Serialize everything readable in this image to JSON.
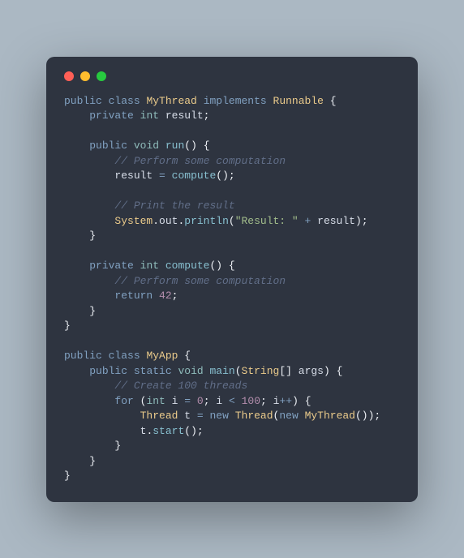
{
  "code": {
    "l1": {
      "kw1": "public",
      "kw2": "class",
      "cls": "MyThread",
      "kw3": "implements",
      "cls2": "Runnable",
      "br": "{"
    },
    "l2": {
      "kw1": "private",
      "tp": "int",
      "id": "result",
      "sc": ";"
    },
    "l3": {
      "kw1": "public",
      "tp": "void",
      "fn": "run",
      "p1": "(",
      "p2": ")",
      "br": "{"
    },
    "l4": {
      "cm": "// Perform some computation"
    },
    "l5": {
      "id1": "result",
      "op": "=",
      "fn": "compute",
      "p1": "(",
      "p2": ")",
      "sc": ";"
    },
    "l6": {
      "cm": "// Print the result"
    },
    "l7": {
      "cls": "System",
      "d1": ".",
      "id": "out",
      "d2": ".",
      "fn": "println",
      "p1": "(",
      "st": "\"Result: \"",
      "op": "+",
      "id2": "result",
      "p2": ")",
      "sc": ";"
    },
    "l8": {
      "br": "}"
    },
    "l9": {
      "kw1": "private",
      "tp": "int",
      "fn": "compute",
      "p1": "(",
      "p2": ")",
      "br": "{"
    },
    "l10": {
      "cm": "// Perform some computation"
    },
    "l11": {
      "kw": "return",
      "nu": "42",
      "sc": ";"
    },
    "l12": {
      "br": "}"
    },
    "l13": {
      "br": "}"
    },
    "l14": {
      "kw1": "public",
      "kw2": "class",
      "cls": "MyApp",
      "br": "{"
    },
    "l15": {
      "kw1": "public",
      "kw2": "static",
      "tp": "void",
      "fn": "main",
      "p1": "(",
      "tp2": "String",
      "brk": "[]",
      "id": "args",
      "p2": ")",
      "br": "{"
    },
    "l16": {
      "cm": "// Create 100 threads"
    },
    "l17": {
      "kw": "for",
      "p1": "(",
      "tp": "int",
      "id1": "i",
      "op1": "=",
      "nu1": "0",
      "sc1": ";",
      "id2": "i",
      "op2": "<",
      "nu2": "100",
      "sc2": ";",
      "id3": "i",
      "op3": "++",
      "p2": ")",
      "br": "{"
    },
    "l18": {
      "cls1": "Thread",
      "id": "t",
      "op": "=",
      "kw": "new",
      "cls2": "Thread",
      "p1": "(",
      "kw2": "new",
      "cls3": "MyThread",
      "p2": "(",
      "p3": ")",
      "p4": ")",
      "sc": ";"
    },
    "l19": {
      "id": "t",
      "d": ".",
      "fn": "start",
      "p1": "(",
      "p2": ")",
      "sc": ";"
    },
    "l20": {
      "br": "}"
    },
    "l21": {
      "br": "}"
    },
    "l22": {
      "br": "}"
    }
  }
}
